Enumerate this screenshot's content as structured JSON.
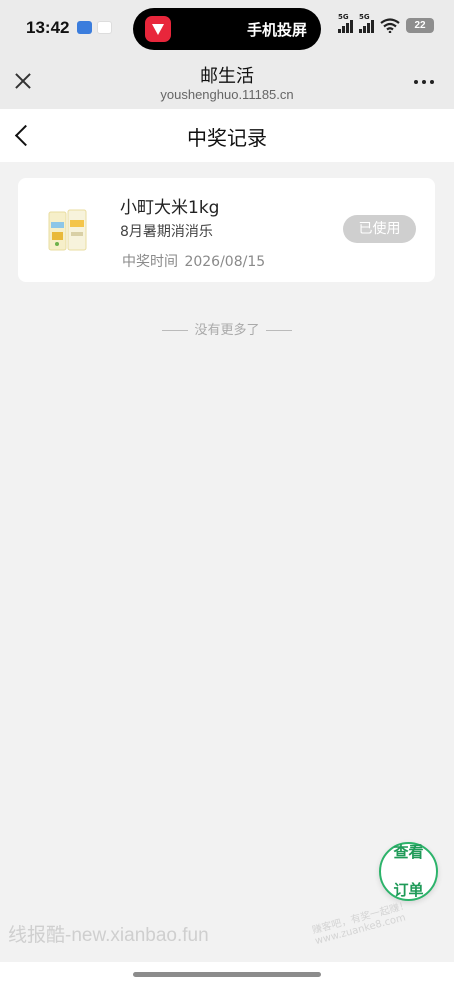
{
  "status_bar": {
    "time": "13:42",
    "island_text": "手机投屏",
    "signal_tag_1": "5G",
    "signal_tag_2": "5G",
    "battery": "22"
  },
  "browser": {
    "title": "邮生活",
    "url": "youshenghuo.11185.cn"
  },
  "page": {
    "title": "中奖记录"
  },
  "prizes": [
    {
      "name": "小町大米1kg",
      "event": "8月暑期消消乐",
      "time_label": "中奖时间",
      "time": "2026/08/15",
      "status": "已使用"
    }
  ],
  "list_end_text": "没有更多了",
  "fab": {
    "line1": "查看",
    "line2": "订单"
  },
  "watermark": {
    "main": "线报酷-new.xianbao.fun",
    "secondary": "赚客吧，有奖一起赚！www.zuanke8.com"
  },
  "colors": {
    "accent_green": "#2cb36a",
    "used_badge_bg": "#cfcfcf",
    "page_bg": "#f2f2f2"
  }
}
